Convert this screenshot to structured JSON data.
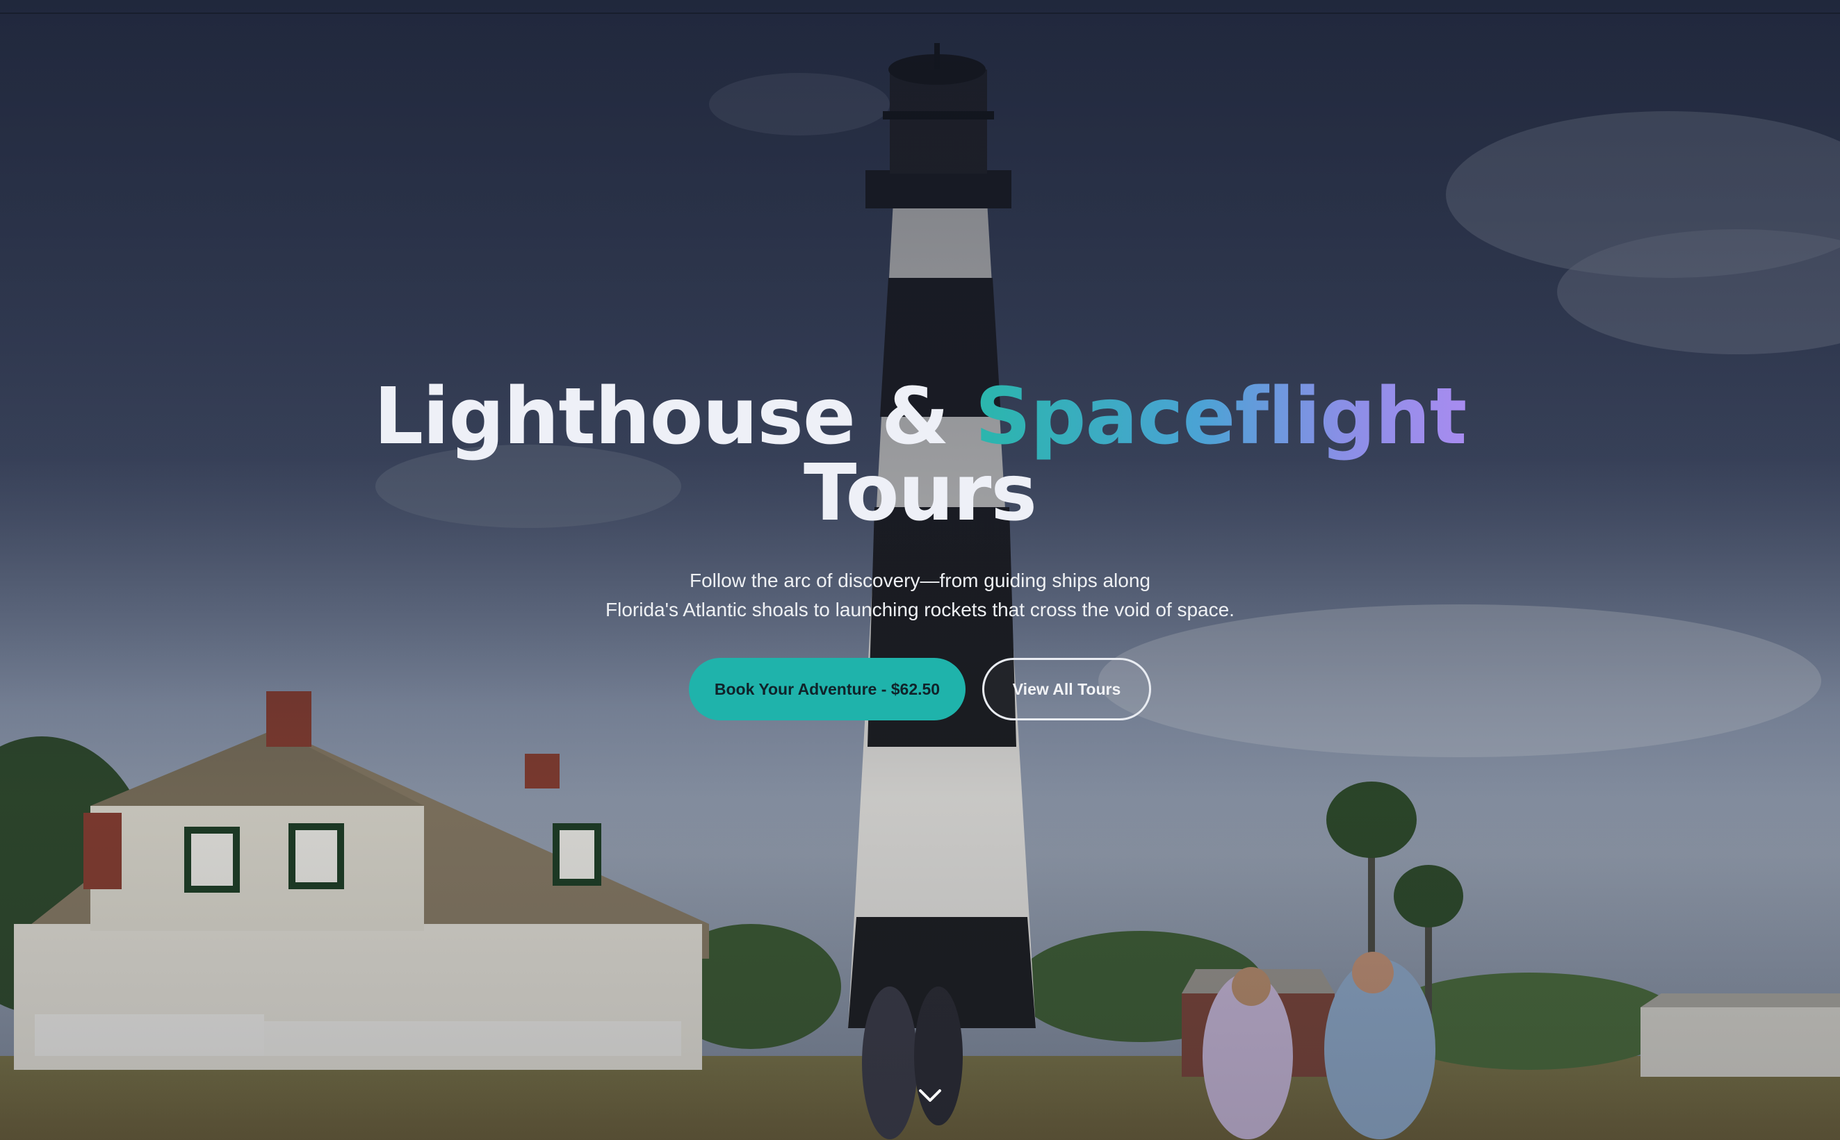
{
  "hero": {
    "title_part1": "Lighthouse & ",
    "title_accent": "Spaceflight",
    "title_part2": "Tours",
    "subtitle_line1": "Follow the arc of discovery—from guiding ships along",
    "subtitle_line2": "Florida's Atlantic shoals to launching rockets that cross the void of space.",
    "primary_button": "Book Your Adventure - $62.50",
    "secondary_button": "View All Tours",
    "scroll_icon": "chevron-down-icon"
  },
  "colors": {
    "accent_start": "#2ab6ac",
    "accent_end": "#a88cf0",
    "primary_button_bg": "#1fb3ab",
    "title_color": "#eef0f7"
  }
}
